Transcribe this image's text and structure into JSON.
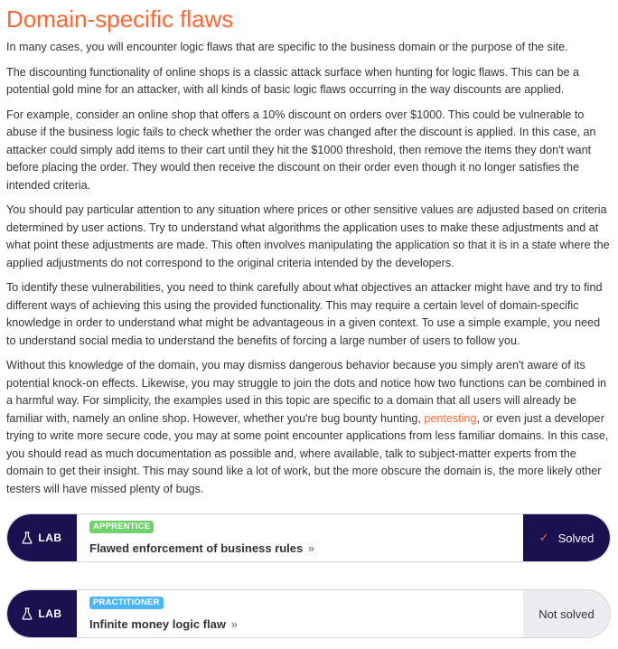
{
  "article": {
    "title": "Domain-specific flaws",
    "paragraphs": [
      "In many cases, you will encounter logic flaws that are specific to the business domain or the purpose of the site.",
      "The discounting functionality of online shops is a classic attack surface when hunting for logic flaws. This can be a potential gold mine for an attacker, with all kinds of basic logic flaws occurring in the way discounts are applied.",
      "For example, consider an online shop that offers a 10% discount on orders over $1000. This could be vulnerable to abuse if the business logic fails to check whether the order was changed after the discount is applied. In this case, an attacker could simply add items to their cart until they hit the $1000 threshold, then remove the items they don't want before placing the order. They would then receive the discount on their order even though it no longer satisfies the intended criteria.",
      "You should pay particular attention to any situation where prices or other sensitive values are adjusted based on criteria determined by user actions. Try to understand what algorithms the application uses to make these adjustments and at what point these adjustments are made. This often involves manipulating the application so that it is in a state where the applied adjustments do not correspond to the original criteria intended by the developers.",
      "To identify these vulnerabilities, you need to think carefully about what objectives an attacker might have and try to find different ways of achieving this using the provided functionality. This may require a certain level of domain-specific knowledge in order to understand what might be advantageous in a given context. To use a simple example, you need to understand social media to understand the benefits of forcing a large number of users to follow you."
    ],
    "last_paragraph": {
      "before_link": "Without this knowledge of the domain, you may dismiss dangerous behavior because you simply aren't aware of its potential knock-on effects. Likewise, you may struggle to join the dots and notice how two functions can be combined in a harmful way. For simplicity, the examples used in this topic are specific to a domain that all users will already be familiar with, namely an online shop. However, whether you're bug bounty hunting, ",
      "link_text": "pentesting",
      "after_link": ", or even just a developer trying to write more secure code, you may at some point encounter applications from less familiar domains. In this case, you should read as much documentation as possible and, where available, talk to subject-matter experts from the domain to get their insight. This may sound like a lot of work, but the more obscure the domain is, the more likely other testers will have missed plenty of bugs."
    }
  },
  "labs": [
    {
      "badge_label": "LAB",
      "level": "APPRENTICE",
      "level_color": "#70d16d",
      "title": "Flawed enforcement of business rules",
      "chevron": "»",
      "status_icon": "check-icon",
      "status_glyph": "✓",
      "status": "Solved"
    },
    {
      "badge_label": "LAB",
      "level": "PRACTITIONER",
      "level_color": "#4cb7f7",
      "title": "Infinite money logic flaw",
      "chevron": "»",
      "status": "Not solved"
    }
  ],
  "colors": {
    "accent": "#ff6633",
    "navy": "#1a1150",
    "text": "#333333"
  }
}
